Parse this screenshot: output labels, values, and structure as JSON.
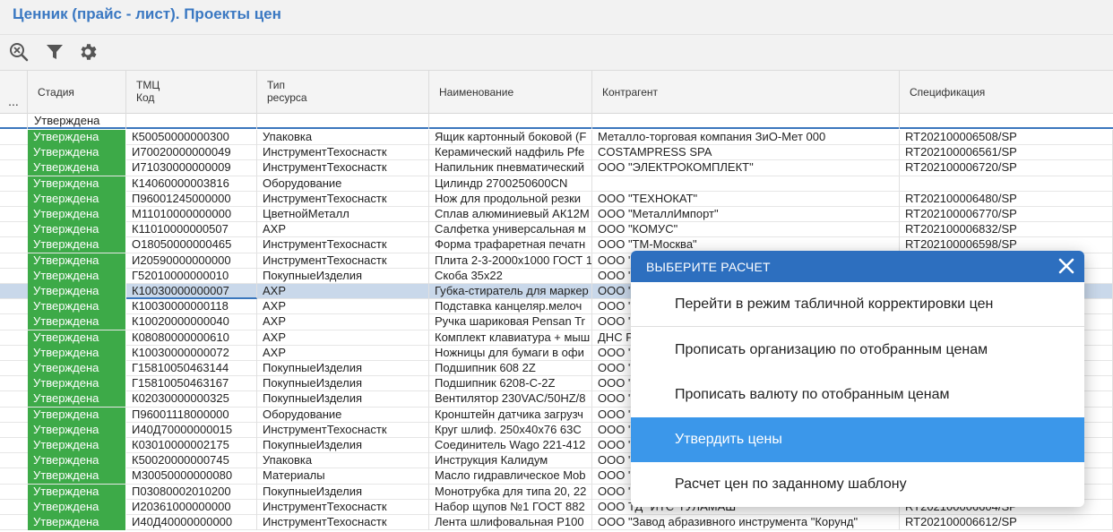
{
  "page": {
    "title": "Ценник (прайс - лист). Проекты цен"
  },
  "grid": {
    "ellipsis": "...",
    "columns": {
      "stage": "Стадия",
      "tmc_line1": "ТМЦ",
      "tmc_line2": "Код",
      "type_line1": "Тип",
      "type_line2": "ресурса",
      "name": "Наименование",
      "contractor": "Контрагент",
      "spec": "Спецификация"
    },
    "filter": {
      "stage": "Утверждена"
    },
    "rows": [
      [
        "Утверждена",
        "К50050000000300",
        "Упаковка",
        "Ящик картонный боковой (F",
        "Металло-торговая компания ЗиО-Мет 000",
        "RT202100006508/SP"
      ],
      [
        "Утверждена",
        "И70020000000049",
        "ИнструментТехоснастк",
        "Керамический надфиль Pfe",
        "COSTAMPRESS SPA",
        "RT202100006561/SP"
      ],
      [
        "Утверждена",
        "И71030000000009",
        "ИнструментТехоснастк",
        "Напильник пневматический",
        "ООО \"ЭЛЕКТРОКОМПЛЕКТ\"",
        "RT202100006720/SP"
      ],
      [
        "Утверждена",
        "К14060000003816",
        "Оборудование",
        "Цилиндр 2700250600CN",
        "",
        ""
      ],
      [
        "Утверждена",
        "П96001245000000",
        "ИнструментТехоснастк",
        "Нож для продольной резки",
        "ООО \"ТЕХНОКАТ\"",
        "RT202100006480/SP"
      ],
      [
        "Утверждена",
        "М11010000000000",
        "ЦветнойМеталл",
        "Сплав алюминиевый АК12М",
        "ООО \"МеталлИмпорт\"",
        "RT202100006770/SP"
      ],
      [
        "Утверждена",
        "К11010000000507",
        "АХР",
        "Салфетка универсальная м",
        "ООО \"КОМУС\"",
        "RT202100006832/SP"
      ],
      [
        "Утверждена",
        "О18050000000465",
        "ИнструментТехоснастк",
        "Форма трафаретная печатн",
        "ООО \"ТМ-Москва\"",
        "RT202100006598/SP"
      ],
      [
        "Утверждена",
        "И20590000000000",
        "ИнструментТехоснастк",
        "Плита 2-3-2000х1000 ГОСТ 1",
        "ООО \"",
        ""
      ],
      [
        "Утверждена",
        "Г52010000000010",
        "ПокупныеИзделия",
        "Скоба 35х22",
        "ООО \"",
        ""
      ],
      [
        "Утверждена",
        "К10030000000007",
        "АХР",
        "Губка-стиратель для маркер",
        "ООО \"",
        ""
      ],
      [
        "Утверждена",
        "К10030000000118",
        "АХР",
        "Подставка канцеляр.мелоч",
        "ООО \"",
        ""
      ],
      [
        "Утверждена",
        "К10020000000040",
        "АХР",
        "Ручка шариковая Pensan Tr",
        "ООО \"",
        ""
      ],
      [
        "Утверждена",
        "К08080000000610",
        "АХР",
        "Комплект клавиатура + мыш",
        "ДНС Р",
        ""
      ],
      [
        "Утверждена",
        "К10030000000072",
        "АХР",
        "Ножницы для бумаги в офи",
        "ООО \"",
        ""
      ],
      [
        "Утверждена",
        "Г15810050463144",
        "ПокупныеИзделия",
        "Подшипник 608 2Z",
        "ООО \"",
        ""
      ],
      [
        "Утверждена",
        "Г15810050463167",
        "ПокупныеИзделия",
        "Подшипник 6208-С-2Z",
        "ООО \"",
        ""
      ],
      [
        "Утверждена",
        "К02030000000325",
        "ПокупныеИзделия",
        "Вентилятор 230VAC/50HZ/8",
        "ООО \"",
        ""
      ],
      [
        "Утверждена",
        "П96001118000000",
        "Оборудование",
        "Кронштейн датчика загрузч",
        "ООО \"",
        ""
      ],
      [
        "Утверждена",
        "И40Д70000000015",
        "ИнструментТехоснастк",
        "Круг шлиф. 250х40х76 63С",
        "ООО \"",
        ""
      ],
      [
        "Утверждена",
        "К03010000002175",
        "ПокупныеИзделия",
        "Соединитель Wago 221-412",
        "ООО \"",
        ""
      ],
      [
        "Утверждена",
        "К50020000000745",
        "Упаковка",
        "Инструкция Калидум",
        "ООО \"",
        ""
      ],
      [
        "Утверждена",
        "М30050000000080",
        "Материалы",
        "Масло гидравлическое Mob",
        "ООО \"",
        ""
      ],
      [
        "Утверждена",
        "П03080002010200",
        "ПокупныеИзделия",
        "Монотрубка для типа 20, 22",
        "ООО \"",
        ""
      ],
      [
        "Утверждена",
        "И20361000000000",
        "ИнструментТехоснастк",
        "Набор щупов №1 ГОСТ 882",
        "ООО ТД \"ИТС\"ТУЛАМАШ\"",
        "RT202100006604/SP"
      ],
      [
        "Утверждена",
        "И40Д40000000000",
        "ИнструментТехоснастк",
        "Лента шлифовальная Р100",
        "ООО \"Завод абразивного инструмента \"Корунд\"",
        "RT202100006612/SP"
      ]
    ],
    "selected_row": 10
  },
  "dialog": {
    "title": "ВЫБЕРИТЕ РАСЧЕТ",
    "options": [
      "Перейти в режим табличной корректировки цен",
      "Прописать организацию по отобранным ценам",
      "Прописать валюту по отобранным ценам",
      "Утвердить цены",
      "Расчет цен по заданному шаблону"
    ],
    "active_option": 3
  },
  "icons": {
    "toolbar": [
      "zoom-reset-icon",
      "filter-icon",
      "gear-icon"
    ],
    "dialog": [
      "close-icon"
    ]
  },
  "colors": {
    "title": "#3a78c2",
    "stage_bg": "#3daa48",
    "selected_row": "#c9d8ea",
    "dialog_header": "#2d6fbf",
    "dialog_active": "#3b97ea"
  }
}
